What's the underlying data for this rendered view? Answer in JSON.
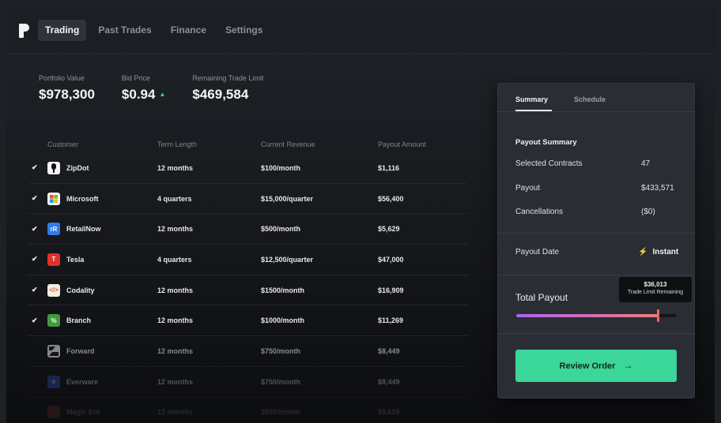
{
  "nav": {
    "items": [
      {
        "label": "Trading",
        "active": true
      },
      {
        "label": "Past Trades",
        "active": false
      },
      {
        "label": "Finance",
        "active": false
      },
      {
        "label": "Settings",
        "active": false
      }
    ]
  },
  "stats": {
    "portfolio_label": "Portfolio Value",
    "portfolio_value": "$978,300",
    "bid_label": "Bid Price",
    "bid_value": "$0.94",
    "bid_trend_icon": "▲",
    "limit_label": "Remaining Trade Limit",
    "limit_value": "$469,584"
  },
  "table": {
    "headers": [
      "Customer",
      "Term Length",
      "Current Revenue",
      "Payout Amount"
    ],
    "rows": [
      {
        "checked": true,
        "name": "ZipDot",
        "icon": "zipdot-logo",
        "term": "12 months",
        "revenue": "$100/month",
        "payout": "$1,116"
      },
      {
        "checked": true,
        "name": "Microsoft",
        "icon": "microsoft-logo",
        "term": "4 quarters",
        "revenue": "$15,000/quarter",
        "payout": "$56,400"
      },
      {
        "checked": true,
        "name": "RetailNow",
        "icon": "retailnow-logo",
        "icon_text": "rR",
        "term": "12 months",
        "revenue": "$500/month",
        "payout": "$5,629"
      },
      {
        "checked": true,
        "name": "Tesla",
        "icon": "tesla-logo",
        "icon_text": "T",
        "term": "4 quarters",
        "revenue": "$12,500/quarter",
        "payout": "$47,000"
      },
      {
        "checked": true,
        "name": "Codality",
        "icon": "codality-logo",
        "icon_text": "</>",
        "term": "12 months",
        "revenue": "$1500/month",
        "payout": "$16,909"
      },
      {
        "checked": true,
        "name": "Branch",
        "icon": "branch-logo",
        "icon_text": "%",
        "term": "12 months",
        "revenue": "$1000/month",
        "payout": "$11,269"
      },
      {
        "checked": false,
        "name": "Forward",
        "icon": "forward-logo",
        "term": "12 months",
        "revenue": "$750/month",
        "payout": "$8,449"
      },
      {
        "checked": false,
        "name": "Everware",
        "icon": "everware-logo",
        "icon_text": "e",
        "term": "12 months",
        "revenue": "$750/month",
        "payout": "$8,449"
      },
      {
        "checked": false,
        "name": "Magic Ent",
        "icon": "magic-ent-logo",
        "term": "12 months",
        "revenue": "$500/month",
        "payout": "$5,629"
      }
    ]
  },
  "panel": {
    "tabs": [
      {
        "label": "Summary",
        "active": true
      },
      {
        "label": "Schedule",
        "active": false
      }
    ],
    "payout_summary_title": "Payout Summary",
    "selected_label": "Selected Contracts",
    "selected_value": "47",
    "payout_label": "Payout",
    "payout_value": "$433,571",
    "cancel_label": "Cancellations",
    "cancel_value": "($0)",
    "payout_date_label": "Payout Date",
    "payout_date_value": "Instant",
    "total_label": "Total Payout",
    "tooltip_amount": "$36,013",
    "tooltip_caption": "Trade Limit Remaining",
    "slider_fraction": 0.89,
    "review_label": "Review Order",
    "review_arrow": "→"
  },
  "colors": {
    "accent_green": "#3ad69a",
    "slider_start": "#b063f0",
    "slider_end": "#f07c7c",
    "bolt_blue": "#4ab3f4"
  }
}
